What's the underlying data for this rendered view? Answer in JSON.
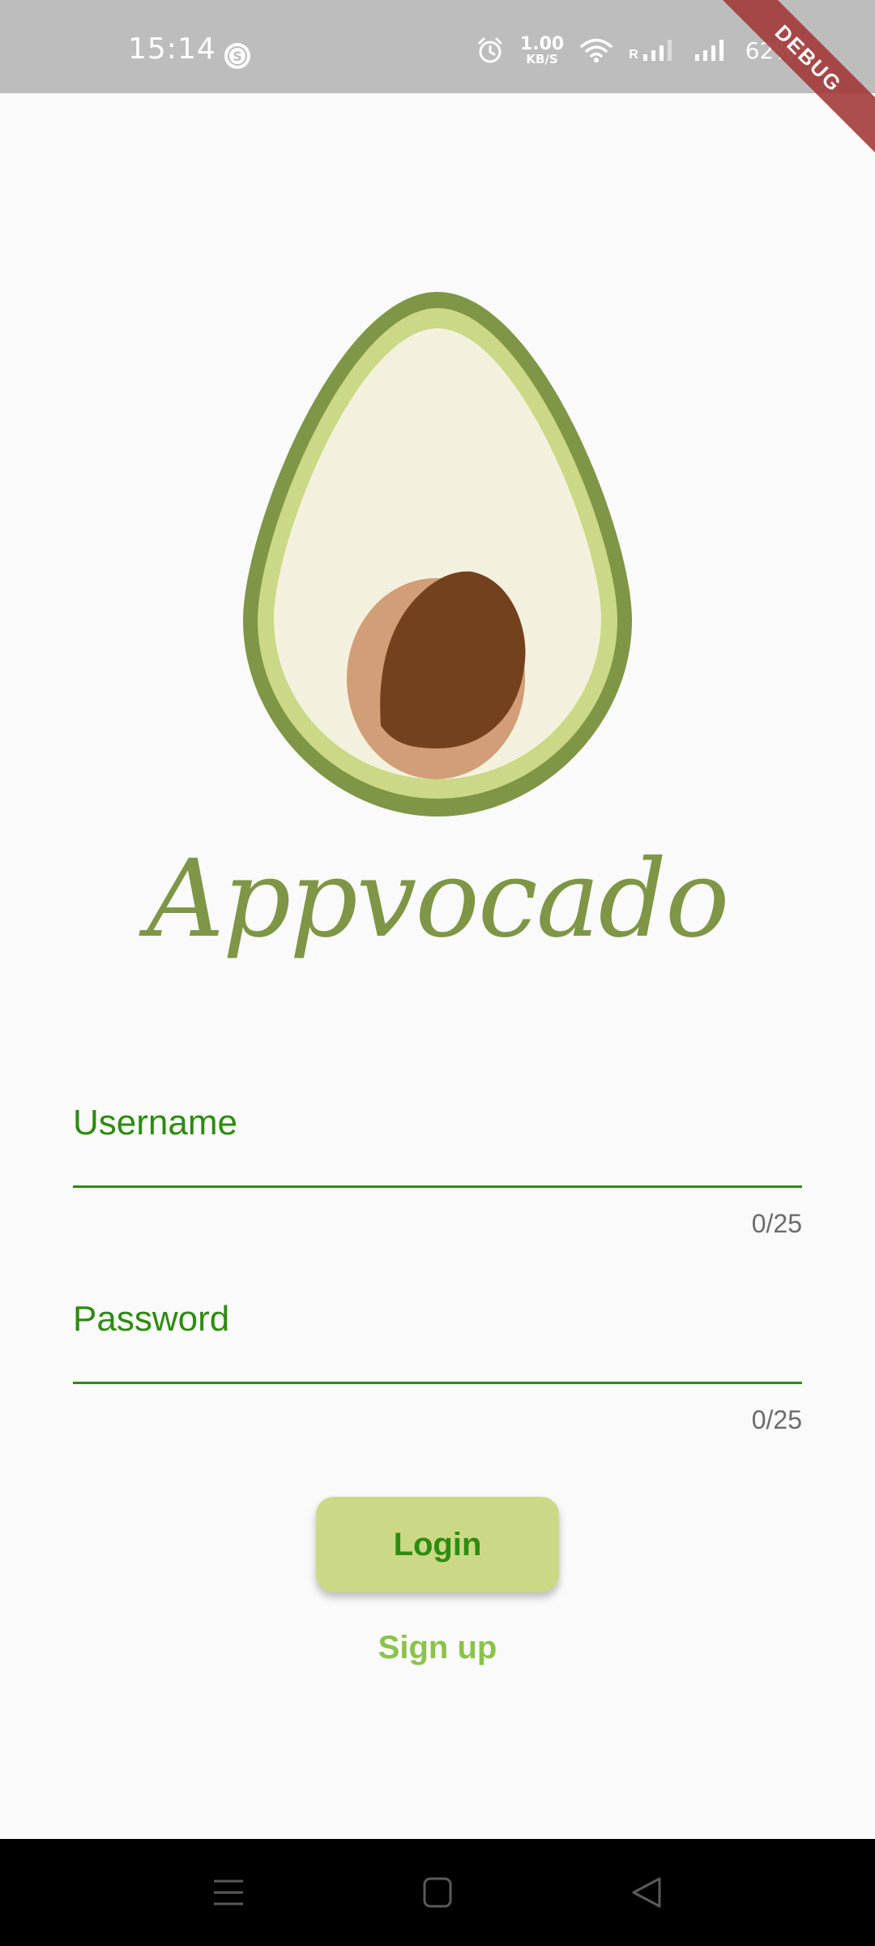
{
  "status_bar": {
    "time": "15:14",
    "app_icon": "s-circle-icon",
    "alarm_icon": "alarm-icon",
    "speed_value": "1.00",
    "speed_unit": "KB/S",
    "wifi_icon": "wifi-icon",
    "signal1_icon": "signal-icon",
    "signal1_roaming": "R",
    "signal2_icon": "signal-icon",
    "battery": "62%",
    "charging_icon": "bolt-icon",
    "debug_banner": "DEBUG"
  },
  "logo": {
    "name": "avocado-logo"
  },
  "app": {
    "title": "Appvocado"
  },
  "form": {
    "username": {
      "label": "Username",
      "value": "",
      "counter": "0/25"
    },
    "password": {
      "label": "Password",
      "value": "",
      "counter": "0/25"
    },
    "login_label": "Login",
    "signup_label": "Sign up"
  },
  "colors": {
    "accent": "#2e8b11",
    "button_bg": "#cbd885",
    "avocado_dark": "#7e9645",
    "avocado_light": "#cbd885",
    "avocado_flesh": "#f3f1de",
    "pit_dark": "#74411e",
    "pit_light": "#d19e77",
    "signup": "#8bc34a"
  },
  "nav": {
    "menu_icon": "menu-icon",
    "home_icon": "home-icon",
    "back_icon": "back-icon"
  }
}
